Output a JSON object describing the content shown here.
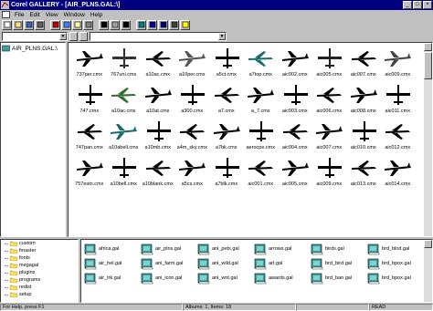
{
  "window": {
    "title": "Corel GALLERY - [AIR_PLNS.GAL:\\]"
  },
  "menu": [
    "File",
    "Edit",
    "View",
    "Window",
    "Help"
  ],
  "toolbar_icons": [
    "new-icon",
    "open-icon",
    "save-icon",
    "print-icon",
    "cut-icon",
    "copy-icon",
    "paste-icon",
    "find-icon",
    "binoculars-icon",
    "scissors-icon",
    "arrow-icon",
    "large-icons-icon",
    "small-icons-icon",
    "list-icon",
    "details-icon",
    "help-icon"
  ],
  "tree": {
    "root": "AIR_PLNS.GAL:\\"
  },
  "clips": [
    "737per.cmx",
    "767uni.cmx",
    "a10ac.cmx",
    "a10per.cmx",
    "a5ct.cmx",
    "a7top.cmx",
    "aic002.cmx",
    "aic005.cmx",
    "aic007.cmx",
    "aic009.cmx",
    "747.cmx",
    "a10ac.cmx",
    "a10at.cmx",
    "a300.cmx",
    "a7.cmx",
    "a_7.cmx",
    "aic003.cmx",
    "aic006.cmx",
    "aic008.cmx",
    "aic011.cmx",
    "747pan.cmx",
    "a10abell.cmx",
    "a10mb.cmx",
    "a4m_sky.cmx",
    "a7bk.cmx",
    "aerocpe.cmx",
    "aic004.cmx",
    "aic007.cmx",
    "aic010.cmx",
    "aic012.cmx",
    "757estn.cmx",
    "a10bell.cmx",
    "a10blank.cmx",
    "a5cs.cmx",
    "a7blk.cmx",
    "aic001.cmx",
    "aic005.cmx",
    "aic009.cmx",
    "aic013.cmx",
    "aic014.cmx"
  ],
  "folders": [
    "custom",
    "fmaster",
    "fonts",
    "megagal",
    "plugins",
    "programs",
    "redist",
    "setup"
  ],
  "galleries": [
    "africa.gal",
    "air_plns.gal",
    "ani_pets.gal",
    "arrows.gal",
    "birds.gal",
    "brd_blnd.gal",
    "air_hel.gal",
    "ani_farm.gal",
    "ani_wild.gal",
    "art.gal",
    "brd_bird.gal",
    "brd_bpox.gal",
    "air_trk.gal",
    "ani_icon.gal",
    "ani_wnt.gal",
    "awards.gal",
    "brd_ban.gal",
    "brd_bpox.gal"
  ],
  "status": {
    "help": "For Help, press F1",
    "albums": "Albums: 1, Items: 18",
    "ready": "READ"
  }
}
